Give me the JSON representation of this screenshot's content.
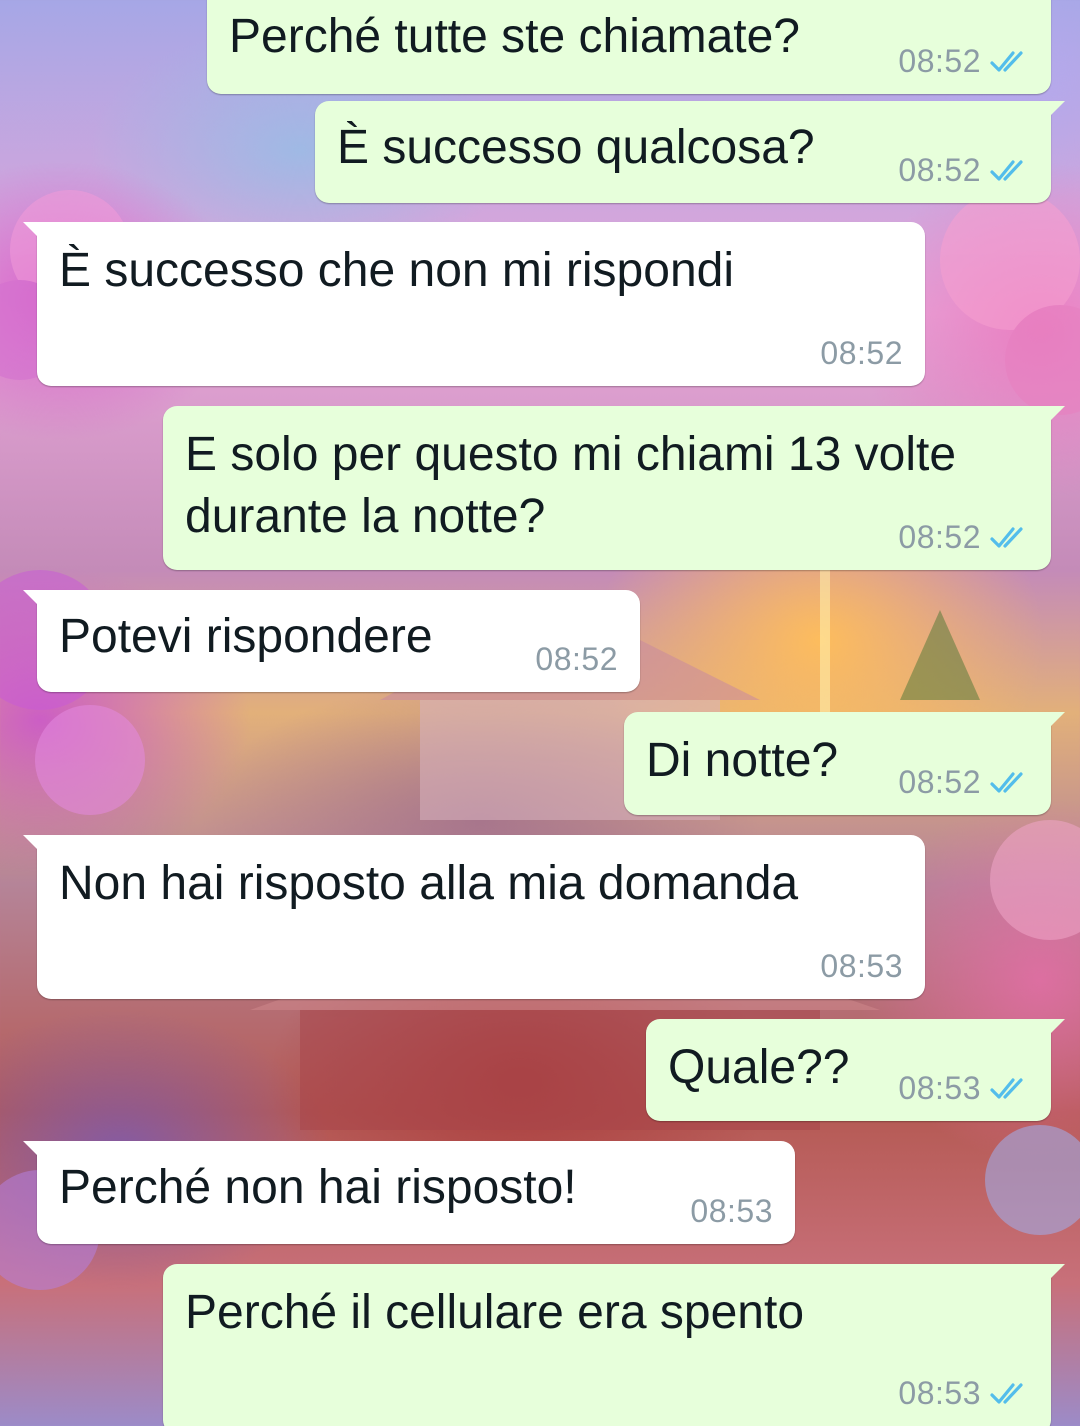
{
  "colors": {
    "outgoing_bubble": "#e7ffdb",
    "incoming_bubble": "#ffffff",
    "timestamp": "#8c9ba5",
    "read_ticks": "#53bdeb"
  },
  "messages": [
    {
      "direction": "outgoing",
      "text": "Perché tutte ste chiamate?",
      "time": "08:52",
      "status_icon": "double-check-read-icon"
    },
    {
      "direction": "outgoing",
      "text": "È successo qualcosa?",
      "time": "08:52",
      "status_icon": "double-check-read-icon"
    },
    {
      "direction": "incoming",
      "text": "È successo che non mi rispondi",
      "time": "08:52"
    },
    {
      "direction": "outgoing",
      "text_lines": [
        "E solo per questo mi chiami 13 volte",
        "durante la notte?"
      ],
      "time": "08:52",
      "status_icon": "double-check-read-icon"
    },
    {
      "direction": "incoming",
      "text": "Potevi rispondere",
      "time": "08:52"
    },
    {
      "direction": "outgoing",
      "text": "Di notte?",
      "time": "08:52",
      "status_icon": "double-check-read-icon"
    },
    {
      "direction": "incoming",
      "text": "Non hai risposto alla mia domanda",
      "time": "08:53"
    },
    {
      "direction": "outgoing",
      "text": "Quale??",
      "time": "08:53",
      "status_icon": "double-check-read-icon"
    },
    {
      "direction": "incoming",
      "text": "Perché non hai risposto!",
      "time": "08:53"
    },
    {
      "direction": "outgoing",
      "text": "Perché il cellulare era spento",
      "time": "08:53",
      "status_icon": "double-check-read-icon"
    }
  ]
}
